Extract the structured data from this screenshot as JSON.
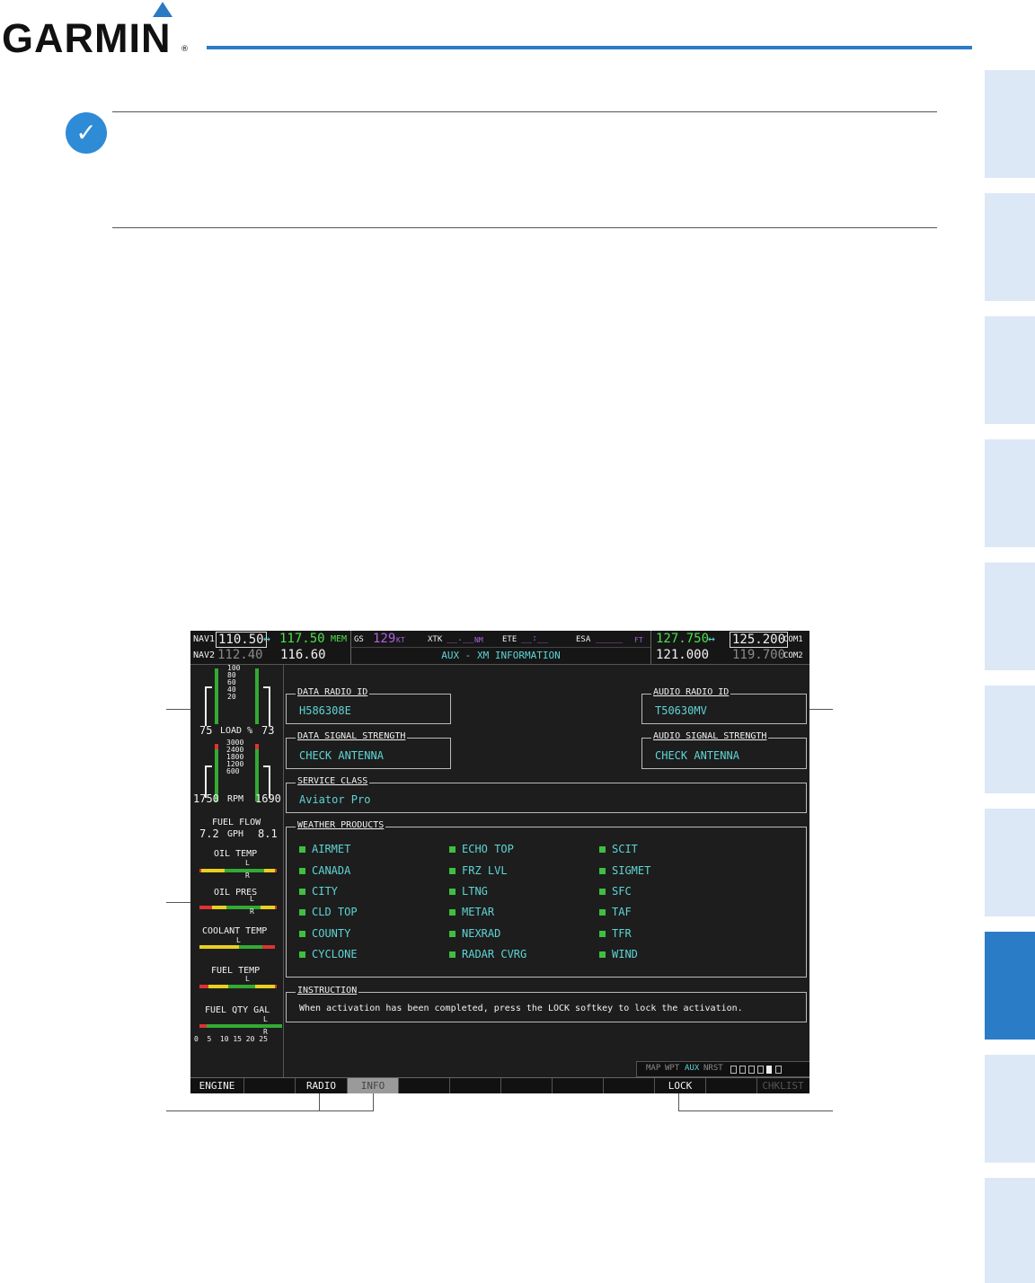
{
  "header": {
    "brand": "GARMIN",
    "reg": "®"
  },
  "screen": {
    "nav1": {
      "label": "NAV1",
      "active": "110.50",
      "standby": "117.50",
      "mem": "MEM"
    },
    "nav2": {
      "label": "NAV2",
      "active": "112.40",
      "standby": "116.60"
    },
    "swap": "↔",
    "gs": {
      "label": "GS",
      "value": "129",
      "unit": "KT"
    },
    "xtk": {
      "label": "XTK",
      "value": "__.__",
      "unit": "NM"
    },
    "ete": {
      "label": "ETE",
      "value": "__:__"
    },
    "esa": {
      "label": "ESA",
      "value": "_____",
      "unit": "FT"
    },
    "page_title": "AUX - XM INFORMATION",
    "com1": {
      "label": "COM1",
      "active": "127.750",
      "standby": "125.200"
    },
    "com2": {
      "label": "COM2",
      "active": "121.000",
      "standby": "119.700"
    },
    "eis": {
      "load_scale": [
        "100",
        "80",
        "60",
        "40",
        "20"
      ],
      "load_left": "75",
      "load_label": "LOAD %",
      "load_right": "73",
      "rpm_scale": [
        "3000",
        "2400",
        "1800",
        "1200",
        "600"
      ],
      "rpm_left": "1750",
      "rpm_label": "RPM",
      "rpm_right": "1690",
      "fuel_flow_label": "FUEL FLOW",
      "ff_left": "7.2",
      "ff_unit": "GPH",
      "ff_right": "8.1",
      "oil_temp": "OIL TEMP",
      "oil_pres": "OIL PRES",
      "coolant_temp": "COOLANT TEMP",
      "fuel_temp": "FUEL TEMP",
      "fuel_qty": "FUEL QTY GAL",
      "fuel_qty_scale": "0  5  10 15 20 25",
      "marker_l": "L",
      "marker_r": "R"
    },
    "data_radio_id": {
      "title": "DATA RADIO ID",
      "value": "H586308E"
    },
    "audio_radio_id": {
      "title": "AUDIO RADIO ID",
      "value": "T50630MV"
    },
    "data_signal": {
      "title": "DATA SIGNAL STRENGTH",
      "value": "CHECK ANTENNA"
    },
    "audio_signal": {
      "title": "AUDIO SIGNAL STRENGTH",
      "value": "CHECK ANTENNA"
    },
    "service_class": {
      "title": "SERVICE CLASS",
      "value": "Aviator Pro"
    },
    "weather_products": {
      "title": "WEATHER PRODUCTS",
      "col1": [
        "AIRMET",
        "CANADA",
        "CITY",
        "CLD TOP",
        "COUNTY",
        "CYCLONE"
      ],
      "col2": [
        "ECHO TOP",
        "FRZ LVL",
        "LTNG",
        "METAR",
        "NEXRAD",
        "RADAR CVRG"
      ],
      "col3": [
        "SCIT",
        "SIGMET",
        "SFC",
        "TAF",
        "TFR",
        "WIND"
      ]
    },
    "instruction": {
      "title": "INSTRUCTION",
      "value": "When activation has been completed, press the LOCK softkey to lock the activation."
    },
    "page_group": {
      "map": "MAP",
      "wpt": "WPT",
      "aux": "AUX",
      "nrst": "NRST"
    },
    "softkeys": [
      "ENGINE",
      "",
      "RADIO",
      "INFO",
      "",
      "",
      "",
      "",
      "",
      "LOCK",
      "",
      "CHKLIST"
    ]
  }
}
